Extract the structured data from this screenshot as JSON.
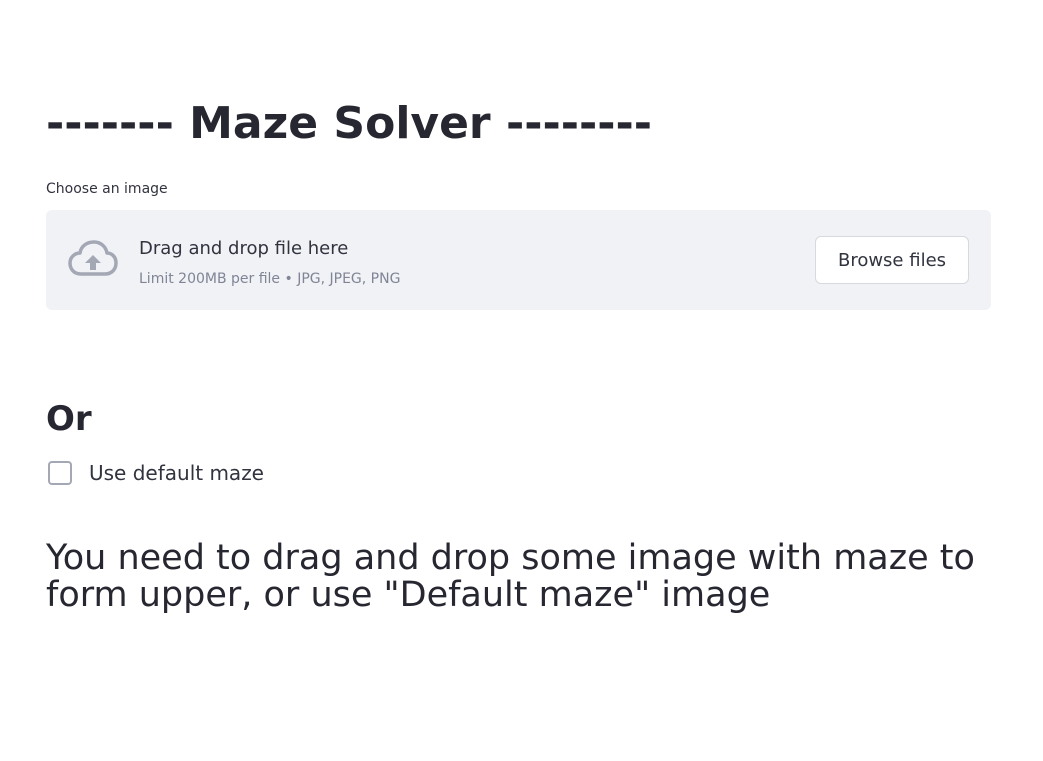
{
  "title": "------- Maze Solver --------",
  "uploader": {
    "label": "Choose an image",
    "instructions": "Drag and drop file here",
    "limit": "Limit 200MB per file • JPG, JPEG, PNG",
    "browse_label": "Browse files",
    "icon": "cloud-upload-icon"
  },
  "or_heading": "Or",
  "default_maze": {
    "label": "Use default maze",
    "checked": false
  },
  "message": "You need to drag and drop some image with maze to form upper, or use \"Default maze\" image",
  "colors": {
    "text": "#262730",
    "dropzone_bg": "#f0f2f6",
    "muted_text": "#808495",
    "icon": "#a3a8b4"
  }
}
